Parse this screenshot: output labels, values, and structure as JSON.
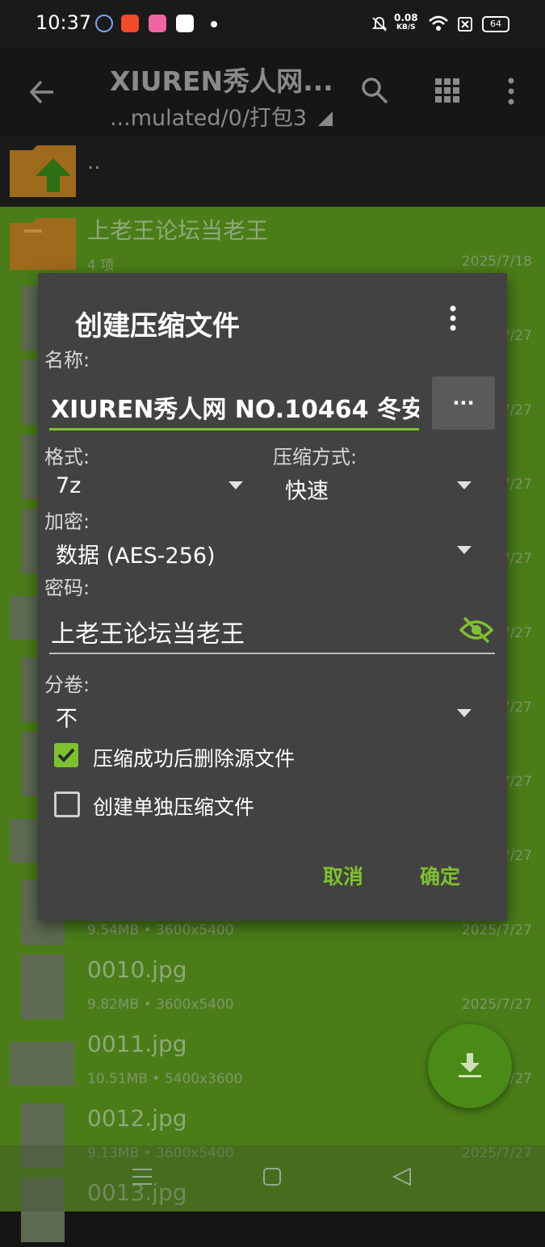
{
  "status_bar": {
    "time": "10:37",
    "net_speed": "0.08",
    "net_unit": "KB/S",
    "battery": "64"
  },
  "toolbar": {
    "title": "XIUREN秀人网...",
    "path": "...mulated/0/打包3"
  },
  "parent_row": {
    "label": ".."
  },
  "files": [
    {
      "name": "上老王论坛当老王",
      "meta": "4 项",
      "date": "2025/7/18",
      "type": "folder"
    },
    {
      "name": "",
      "meta": "",
      "date": "2025/7/27",
      "type": "image"
    },
    {
      "name": "",
      "meta": "",
      "date": "2025/7/27",
      "type": "image"
    },
    {
      "name": "",
      "meta": "",
      "date": "2025/7/27",
      "type": "image"
    },
    {
      "name": "",
      "meta": "",
      "date": "2025/7/27",
      "type": "image"
    },
    {
      "name": "",
      "meta": "",
      "date": "2025/7/27",
      "type": "image"
    },
    {
      "name": "",
      "meta": "",
      "date": "2025/7/27",
      "type": "image"
    },
    {
      "name": "",
      "meta": "",
      "date": "2025/7/27",
      "type": "image"
    },
    {
      "name": "",
      "meta": "",
      "date": "2025/7/27",
      "type": "image"
    },
    {
      "name": "",
      "meta": "9.54MB • 3600x5400",
      "date": "2025/7/27",
      "type": "image"
    },
    {
      "name": "0010.jpg",
      "meta": "9.82MB • 3600x5400",
      "date": "2025/7/27",
      "type": "image"
    },
    {
      "name": "0011.jpg",
      "meta": "10.51MB • 5400x3600",
      "date": "2025/7/27",
      "type": "image"
    },
    {
      "name": "0012.jpg",
      "meta": "9.13MB • 3600x5400",
      "date": "2025/7/27",
      "type": "image"
    },
    {
      "name": "0013.jpg",
      "meta": "",
      "date": "",
      "type": "image"
    }
  ],
  "dialog": {
    "title": "创建压缩文件",
    "name_label": "名称:",
    "name_value": "XIUREN秀人网 NO.10464 冬安",
    "more_button": "...",
    "format_label": "格式:",
    "format_value": "7z",
    "method_label": "压缩方式:",
    "method_value": "快速",
    "encryption_label": "加密:",
    "encryption_value": "数据 (AES-256)",
    "password_label": "密码:",
    "password_value": "上老王论坛当老王",
    "split_label": "分卷:",
    "split_value": "不",
    "delete_source_label": "压缩成功后删除源文件",
    "delete_source_checked": true,
    "separate_archives_label": "创建单独压缩文件",
    "separate_archives_checked": false,
    "cancel": "取消",
    "ok": "确定"
  },
  "colors": {
    "accent": "#7ec12f",
    "list_bg": "#4a7d18",
    "dialog_bg": "#424242"
  }
}
